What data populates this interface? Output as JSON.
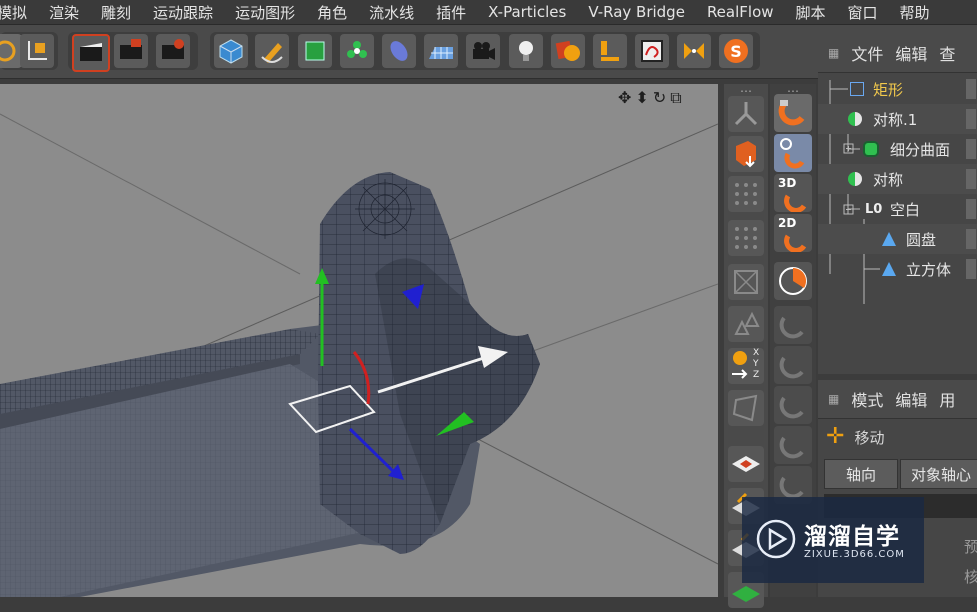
{
  "menu": [
    "模拟",
    "渲染",
    "雕刻",
    "运动跟踪",
    "运动图形",
    "角色",
    "流水线",
    "插件",
    "X-Particles",
    "V-Ray Bridge",
    "RealFlow",
    "脚本",
    "窗口",
    "帮助"
  ],
  "toolbar": {
    "icons": [
      "spiral-icon",
      "axis-icon",
      "render-view-icon",
      "render-icon",
      "render-settings-icon",
      "cube-icon",
      "pen-icon",
      "subdivision-icon",
      "cloner-icon",
      "deformer-icon",
      "floor-icon",
      "camera-icon",
      "light-icon",
      "material-icon",
      "align-icon",
      "xpresso-icon",
      "symmetry-icon",
      "s-icon"
    ]
  },
  "object_manager": {
    "tabs": [
      "文件",
      "编辑",
      "查"
    ],
    "items": [
      {
        "label": "矩形",
        "color": "#f2c94c"
      },
      {
        "label": "对称.1",
        "color": "#e6e6e6"
      },
      {
        "label": "细分曲面",
        "color": "#e6e6e6"
      },
      {
        "label": "对称",
        "color": "#e6e6e6"
      },
      {
        "label": "空白",
        "color": "#e6e6e6"
      },
      {
        "label": "圆盘",
        "color": "#e6e6e6"
      },
      {
        "label": "立方体",
        "color": "#e6e6e6"
      }
    ],
    "null_prefix": "L0"
  },
  "attributes": {
    "tabs": [
      "模式",
      "编辑",
      "用"
    ],
    "tool_name": "移动",
    "buttons": [
      "轴向",
      "对象轴心"
    ],
    "side_labels": [
      "预",
      "核"
    ]
  },
  "snap_labels": [
    "3D",
    "2D"
  ],
  "xyz_labels": [
    "X",
    "Y",
    "Z"
  ],
  "watermark": {
    "title": "溜溜自学",
    "url": "ZIXUE.3D66.COM"
  },
  "colors": {
    "accent": "#f2c94c",
    "x_axis": "#d02020",
    "y_axis": "#20c020",
    "z_axis": "#2020d0"
  }
}
